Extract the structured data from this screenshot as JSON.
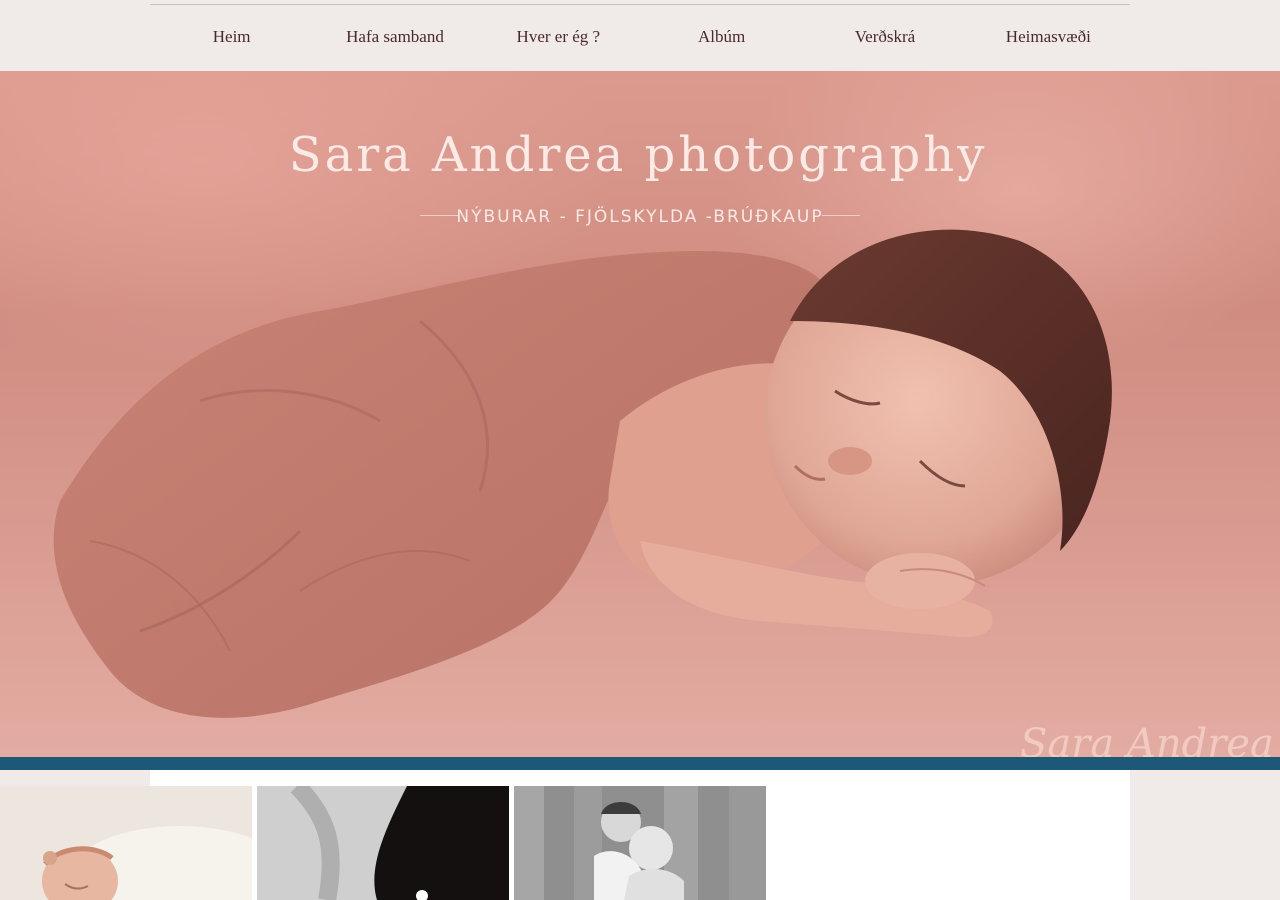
{
  "nav": {
    "items": [
      {
        "label": "Heim"
      },
      {
        "label": "Hafa samband"
      },
      {
        "label": "Hver er ég ?"
      },
      {
        "label": "Albúm"
      },
      {
        "label": "Verðskrá"
      },
      {
        "label": "Heimasvæði"
      }
    ]
  },
  "hero": {
    "title": "Sara Andrea photography",
    "subtitle": "NÝBURAR - FJÖLSKYLDA -BRÚÐKAUP",
    "watermark": "Sara Andrea"
  },
  "gallery": {
    "thumbs": [
      {
        "name": "newborn-headband-photo"
      },
      {
        "name": "black-white-detail-photo"
      },
      {
        "name": "brothers-photo"
      }
    ]
  },
  "colors": {
    "nav_bg": "#f0ebe9",
    "nav_text": "#4a2a28",
    "hero_title": "#fbeae6",
    "accent_band": "#1e5878"
  }
}
